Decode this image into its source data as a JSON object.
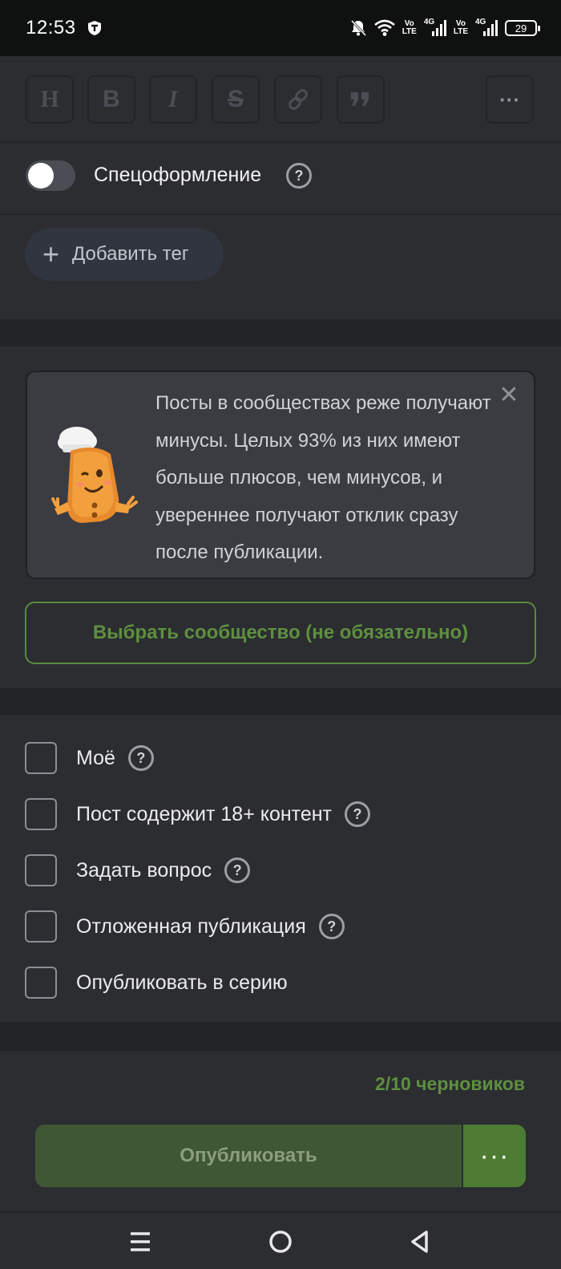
{
  "status_bar": {
    "time": "12:53",
    "signal1_label_top": "Vo",
    "signal1_label_bottom": "LTE",
    "signal1_net": "4G",
    "signal2_label_top": "Vo",
    "signal2_label_bottom": "LTE",
    "signal2_net": "4G",
    "battery": "29"
  },
  "toolbar": {
    "heading": "H",
    "bold": "B",
    "italic": "I",
    "strike": "S",
    "more": "···"
  },
  "spec": {
    "label": "Спецоформление",
    "enabled": false
  },
  "tags": {
    "add_label": "Добавить тег"
  },
  "community": {
    "info_text": "Посты в сообществах реже получают минусы. Целых 93% из них имеют больше плюсов, чем минусов, и увереннее получают отклик сразу после публикации.",
    "choose_label": "Выбрать сообщество (не обязательно)"
  },
  "options": [
    {
      "label": "Моё",
      "help": true
    },
    {
      "label": "Пост содержит 18+ контент",
      "help": true
    },
    {
      "label": "Задать вопрос",
      "help": true
    },
    {
      "label": "Отложенная публикация",
      "help": true
    },
    {
      "label": "Опубликовать в серию",
      "help": false
    }
  ],
  "footer": {
    "drafts": "2/10 черновиков",
    "publish_label": "Опубликовать",
    "more_label": "···"
  },
  "colors": {
    "accent_green": "#5e8f3f",
    "background": "#2b2d31",
    "divider": "#232428"
  }
}
